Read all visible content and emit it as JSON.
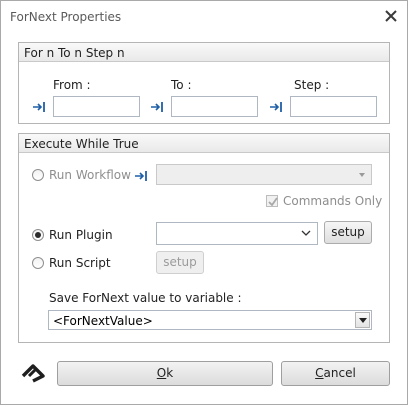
{
  "window": {
    "title": "ForNext Properties"
  },
  "for_group": {
    "title": "For n To n Step n",
    "from_label": "From :",
    "to_label": "To :",
    "step_label": "Step :",
    "from_value": "",
    "to_value": "",
    "step_value": ""
  },
  "execute_group": {
    "title": "Execute While True",
    "run_workflow_label": "Run Workflow",
    "workflow_value": "",
    "commands_only_label": "Commands Only",
    "run_plugin_label": "Run Plugin",
    "plugin_value": "",
    "setup_label": "setup",
    "run_script_label": "Run Script",
    "script_setup_label": "setup",
    "save_label": "Save ForNext value to variable :",
    "save_value": "<ForNextValue>",
    "selected_mode": "Run Plugin",
    "commands_only_checked": true
  },
  "footer": {
    "ok_label": "Ok",
    "ok_mnemonic": "O",
    "ok_rest": "k",
    "cancel_label": "Cancel",
    "cancel_mnemonic": "C",
    "cancel_rest": "ancel"
  },
  "icons": {
    "close": "close-icon",
    "variable": "variable-insert-icon",
    "logo": "app-logo-icon"
  },
  "colors": {
    "accent": "#1f5fa8",
    "group_header": "#ececec",
    "border": "#b5b5b5"
  }
}
